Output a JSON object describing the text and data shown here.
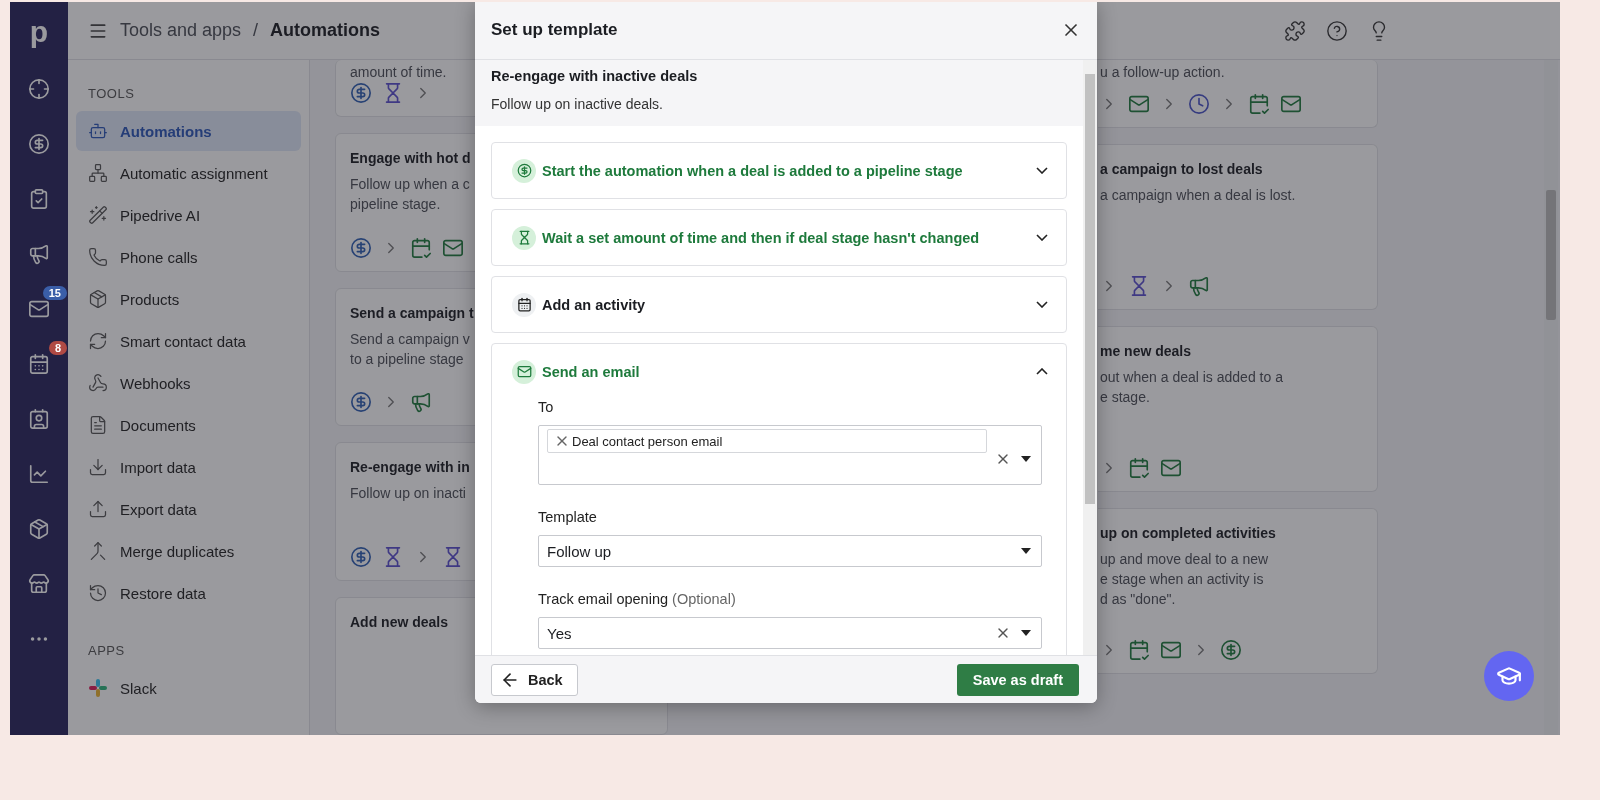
{
  "rail": {
    "logo": "p",
    "mail_badge": {
      "text": "15",
      "color": "#3a5ea8"
    },
    "calendar_badge": {
      "text": "8",
      "color": "#b04a44"
    }
  },
  "header": {
    "breadcrumb_parent": "Tools and apps",
    "separator": "/",
    "current": "Automations"
  },
  "sidebar": {
    "sections": [
      {
        "heading": "TOOLS",
        "items": [
          {
            "label": "Automations",
            "selected": true
          },
          {
            "label": "Automatic assignment",
            "selected": false
          },
          {
            "label": "Pipedrive AI",
            "selected": false
          },
          {
            "label": "Phone calls",
            "selected": false
          },
          {
            "label": "Products",
            "selected": false
          },
          {
            "label": "Smart contact data",
            "selected": false
          },
          {
            "label": "Webhooks",
            "selected": false
          },
          {
            "label": "Documents",
            "selected": false
          },
          {
            "label": "Import data",
            "selected": false
          },
          {
            "label": "Export data",
            "selected": false
          },
          {
            "label": "Merge duplicates",
            "selected": false
          },
          {
            "label": "Restore data",
            "selected": false
          }
        ]
      },
      {
        "heading": "APPS",
        "items": [
          {
            "label": "Slack",
            "selected": false
          }
        ]
      }
    ]
  },
  "cards_left": [
    {
      "description_lines": [
        "amount of time."
      ]
    },
    {
      "title": "Engage with hot d",
      "description_lines": [
        "Follow up when a c",
        "pipeline stage."
      ]
    },
    {
      "title": "Send a campaign t",
      "description_lines": [
        "Send a campaign v",
        "to a pipeline stage"
      ]
    },
    {
      "title": "Re-engage with in",
      "description_lines": [
        "Follow up on inacti"
      ]
    },
    {
      "title": "Add new deals"
    }
  ],
  "cards_right": [
    {
      "description_lines": [
        "u a follow-up action."
      ]
    },
    {
      "title": "a campaign to lost deals",
      "description_lines": [
        "a campaign when a deal is lost."
      ]
    },
    {
      "title": "me new deals",
      "description_lines": [
        "out when a deal is added to a",
        "e stage."
      ]
    },
    {
      "title": "up on completed activities",
      "description_lines": [
        "up and move deal to a new",
        "e stage when an activity is",
        "d as \"done\"."
      ]
    }
  ],
  "modal": {
    "title": "Set up template",
    "template_name": "Re-engage with inactive deals",
    "template_description": "Follow up on inactive deals.",
    "steps": [
      {
        "title": "Start the automation when a deal is added to a pipeline stage",
        "configured": true,
        "expanded": false
      },
      {
        "title": "Wait a set amount of time and then if deal stage hasn't changed",
        "configured": true,
        "expanded": false
      },
      {
        "title": "Add an activity",
        "configured": false,
        "expanded": false
      },
      {
        "title": "Send an email",
        "configured": true,
        "expanded": true
      }
    ],
    "email_form": {
      "to_label": "To",
      "to_chips": [
        "Deal contact person email"
      ],
      "template_label": "Template",
      "template_value": "Follow up",
      "tracking_label": "Track email opening",
      "tracking_optional": "(Optional)",
      "tracking_value": "Yes"
    },
    "back_button": "Back",
    "save_button": "Save as draft"
  }
}
